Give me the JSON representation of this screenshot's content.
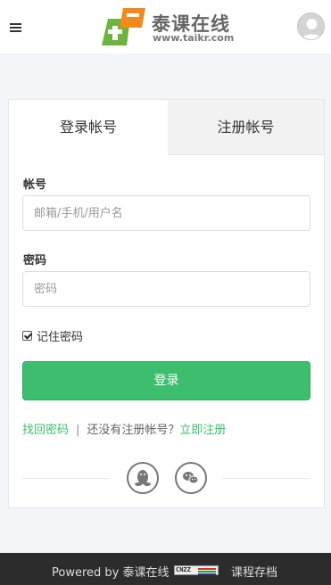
{
  "header": {
    "menu_icon": "hamburger-menu-icon",
    "logo": {
      "name": "泰课在线",
      "url": "www.taikr.com",
      "colors": {
        "orange": "#f08a1c",
        "green": "#6db33f"
      }
    },
    "avatar_icon": "user-avatar-icon"
  },
  "tabs": {
    "login": "登录帐号",
    "register": "注册帐号"
  },
  "form": {
    "account_label": "帐号",
    "account_placeholder": "邮箱/手机/用户名",
    "password_label": "密码",
    "password_placeholder": "密码",
    "remember_label": "记住密码",
    "remember_checked": true,
    "submit_label": "登录"
  },
  "links": {
    "forgot": "找回密码",
    "separator": "|",
    "no_account": "还没有注册帐号？",
    "register_now": "立即注册"
  },
  "social": {
    "qq_icon": "qq-icon",
    "wechat_icon": "wechat-icon"
  },
  "footer": {
    "powered_by": "Powered by 泰课在线",
    "badge_text": "CNZZ",
    "archive_link": "课程存档"
  },
  "colors": {
    "accent": "#3dbe6f",
    "footer_bg": "#2c2c2c",
    "page_bg": "#f3f6f9"
  }
}
